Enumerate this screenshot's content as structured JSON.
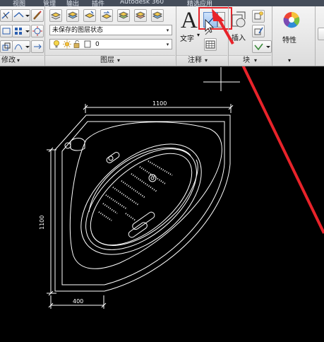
{
  "menubar": {
    "items": [
      "视图",
      "管理",
      "输出",
      "插件",
      "Autodesk 360",
      "精选应用"
    ]
  },
  "ribbon": {
    "modify_panel_label": "修改",
    "layer_state": "未保存的图层状态",
    "layer_value": "0",
    "layers_panel_label": "图层",
    "text_button_label": "文字",
    "text_glyph": "A",
    "annotation_panel_label": "注释",
    "insert_button_label": "插入",
    "block_panel_label": "块",
    "properties_button_label": "特性",
    "dropdown_arrow": "▾"
  },
  "drawing": {
    "dim_top": "1100",
    "dim_left": "1100",
    "dim_bottom": "400"
  },
  "colors": {
    "highlight": "#e8232a",
    "arrow": "#e8232a",
    "ribbon_bg": "#e6e6e6",
    "canvas": "#000000"
  }
}
